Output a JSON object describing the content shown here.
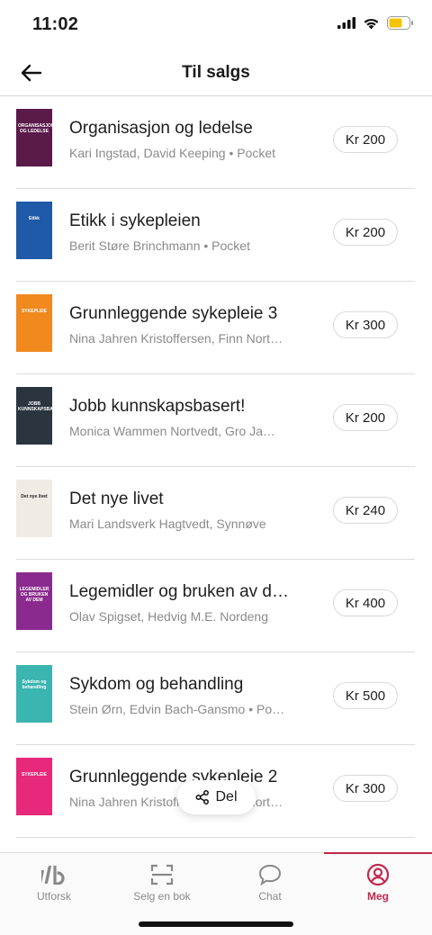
{
  "status": {
    "time": "11:02"
  },
  "header": {
    "title": "Til salgs"
  },
  "books": [
    {
      "title": "Organisasjon og ledelse",
      "authors": "Kari Ingstad, David Keeping • Pocket",
      "price": "Kr 200",
      "cover": {
        "bg": "#5a1a4a",
        "accent": "#ffffff",
        "text": "ORGANISASJON OG LEDELSE"
      }
    },
    {
      "title": "Etikk i sykepleien",
      "authors": "Berit Støre Brinchmann • Pocket",
      "price": "Kr 200",
      "cover": {
        "bg": "#1e5aa8",
        "accent": "#ffffff",
        "text": "Etikk"
      }
    },
    {
      "title": "Grunnleggende sykepleie 3",
      "authors": "Nina Jahren Kristoffersen, Finn Nortvedt",
      "price": "Kr 300",
      "cover": {
        "bg": "#f0891e",
        "accent": "#ffffff",
        "text": "SYKEPLEIE"
      }
    },
    {
      "title": "Jobb kunnskapsbasert!",
      "authors": "Monica Wammen Nortvedt, Gro Jamtvedt",
      "price": "Kr 200",
      "cover": {
        "bg": "#2a3540",
        "accent": "#ffffff",
        "text": "JOBB KUNNSKAPSBASERT"
      }
    },
    {
      "title": "Det nye livet",
      "authors": "Mari Landsverk Hagtvedt, Synnøve",
      "price": "Kr 240",
      "cover": {
        "bg": "#f1ebe6",
        "accent": "#222222",
        "text": "Det nye livet"
      }
    },
    {
      "title": "Legemidler og bruken av dem",
      "authors": "Olav Spigset, Hedvig M.E. Nordeng",
      "price": "Kr 400",
      "cover": {
        "bg": "#8a2a8e",
        "accent": "#ffffff",
        "text": "LEGEMIDLER OG BRUKEN AV DEM"
      }
    },
    {
      "title": "Sykdom og behandling",
      "authors": "Stein Ørn, Edvin Bach-Gansmo • Pocket",
      "price": "Kr 500",
      "cover": {
        "bg": "#3ab5b0",
        "accent": "#ffffff",
        "text": "Sykdom og behandling"
      }
    },
    {
      "title": "Grunnleggende sykepleie 2",
      "authors": "Nina Jahren Kristoffersen, Finn Nortvedt",
      "price": "Kr 300",
      "cover": {
        "bg": "#e8287a",
        "accent": "#ffffff",
        "text": "SYKEPLEIE"
      }
    }
  ],
  "share": {
    "label": "Del"
  },
  "tabs": [
    {
      "label": "Utforsk",
      "icon": "explore-icon"
    },
    {
      "label": "Selg en bok",
      "icon": "scan-icon"
    },
    {
      "label": "Chat",
      "icon": "chat-icon"
    },
    {
      "label": "Meg",
      "icon": "profile-icon"
    }
  ],
  "colors": {
    "accent": "#c0284d",
    "muted": "#8a8a8a",
    "divider": "#dcdcdc"
  }
}
